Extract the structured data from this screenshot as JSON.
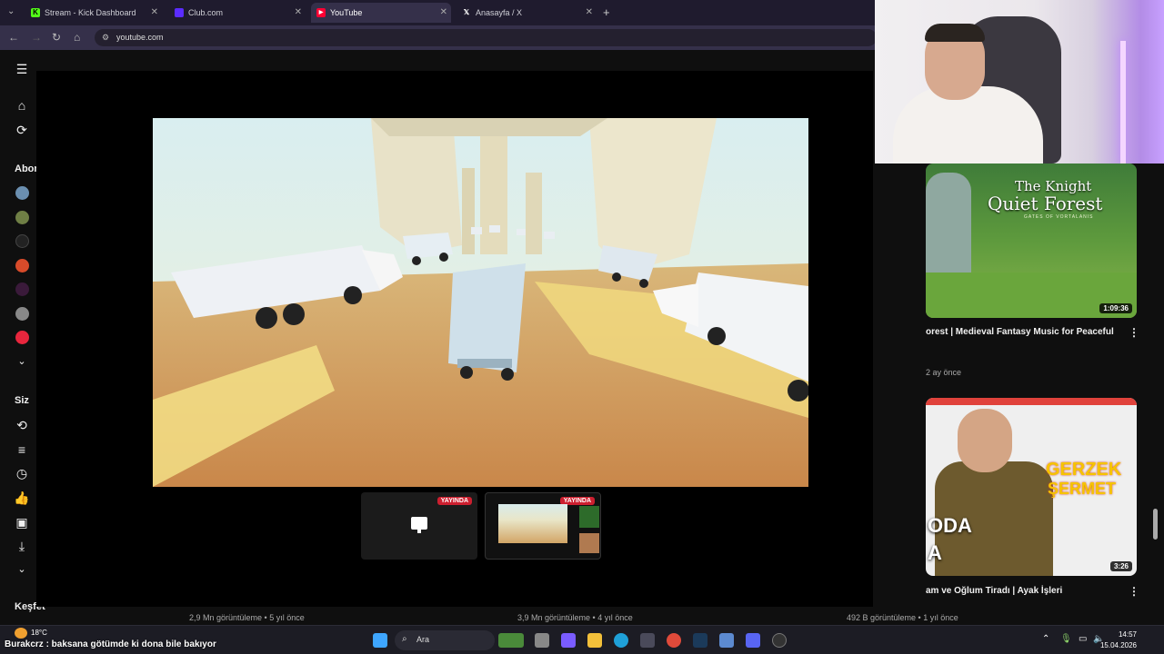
{
  "browser": {
    "tabs": [
      {
        "label": "Stream - Kick Dashboard",
        "icon": "kick-icon"
      },
      {
        "label": "Club.com",
        "icon": "club-icon"
      },
      {
        "label": "YouTube",
        "icon": "youtube-icon",
        "active": true
      },
      {
        "label": "Anasayfa / X",
        "icon": "x-icon"
      }
    ],
    "url": "youtube.com"
  },
  "sidebar": {
    "subscriptions_label": "Abon",
    "you_label": "Siz",
    "explore_label": "Keşfet"
  },
  "stream_scenes": {
    "live_badge": "YAYINDA"
  },
  "recommendations": [
    {
      "thumb_title_line1": "The Knight",
      "thumb_title_line2": "Quiet Forest",
      "thumb_subtitle": "GATES OF VORTALANIS",
      "duration": "1:09:36",
      "title": "orest | Medieval Fantasy Music for Peaceful",
      "meta": "2 ay önce"
    },
    {
      "thumb_text_1": "GERZEK",
      "thumb_text_2": "ŞERMET",
      "thumb_text_3": "ODA",
      "thumb_text_4": "A",
      "duration": "3:26",
      "title": "am ve Oğlum Tiradı | Ayak İşleri"
    }
  ],
  "bottom_row_meta": [
    "2,9 Mn görüntüleme • 5 yıl önce",
    "3,9 Mn görüntüleme • 4 yıl önce",
    "492 B görüntüleme • 1 yıl önce"
  ],
  "taskbar": {
    "weather": "18°C",
    "search_label": "Ara",
    "time": "14:57",
    "date": "15.04.2026"
  },
  "chat_overlay": "Burakcrz : baksana götümde ki dona bile bakıyor",
  "colors": {
    "youtube_red": "#ff0033",
    "live_red": "#cc1f2f",
    "kick_green": "#53fc18",
    "club_purple": "#5b2cff"
  }
}
